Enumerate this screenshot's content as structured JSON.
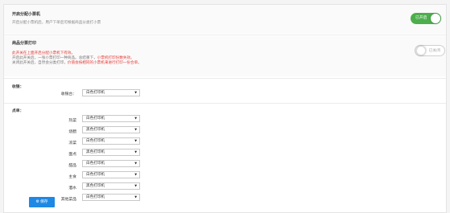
{
  "split_print": {
    "title": "开启分配小票机",
    "desc": "开启分配小票机后，用户下单后可根据商品分类打小票",
    "toggle_label": "已开启",
    "toggle_on": true
  },
  "item_split": {
    "title": "商品分票打印",
    "toggle_label": "已关闭",
    "toggle_on": false,
    "notes": [
      {
        "parts": [
          {
            "text": "此开关在上面开启分配小票机下有效。",
            "tone": "red"
          }
        ]
      },
      {
        "parts": [
          {
            "text": "开启此开关后，一张小票打印一种商品。总结重下，",
            "tone": "gray"
          },
          {
            "text": "小票机打印份数失效。",
            "tone": "red"
          }
        ]
      },
      {
        "parts": [
          {
            "text": "关闭此开关后，自然会分类打印，",
            "tone": "gray"
          },
          {
            "text": "价值会按相同的小票机来进行打印一份合单。",
            "tone": "red"
          }
        ]
      }
    ]
  },
  "cashier": {
    "label": "收银：",
    "rows": [
      {
        "label": "收银台：",
        "value": "白色打印机"
      }
    ]
  },
  "dishes": {
    "label": "点单：",
    "rows": [
      {
        "label": "热菜",
        "value": "白色打印机"
      },
      {
        "label": "烧腊",
        "value": "黑色打印机"
      },
      {
        "label": "凉菜",
        "value": "白色打印机"
      },
      {
        "label": "面点",
        "value": "黑色打印机"
      },
      {
        "label": "甜品",
        "value": "白色打印机"
      },
      {
        "label": "主食",
        "value": "白色打印机"
      },
      {
        "label": "酒水",
        "value": "黑色打印机"
      },
      {
        "label": "其他菜品",
        "value": "白色打印机"
      }
    ]
  },
  "actions": {
    "save_label": "保存"
  }
}
